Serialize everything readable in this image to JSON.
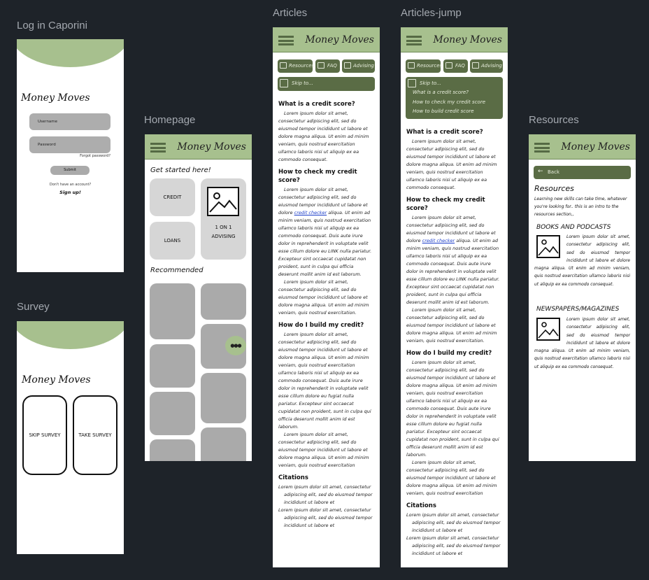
{
  "frames": {
    "login": "Log in Caporini",
    "homepage": "Homepage",
    "survey": "Survey",
    "articles": "Articles",
    "articles_jump": "Articles-jump",
    "resources": "Resources"
  },
  "app_title": "Money Moves",
  "login": {
    "username": "Username",
    "password": "Password",
    "forgot": "Forgot password?",
    "submit": "Submit",
    "no_account": "Don't have an account?",
    "signup": "Sign up!"
  },
  "survey": {
    "skip": "SKIP SURVEY",
    "take": "TAKE SURVEY"
  },
  "home": {
    "get_started": "Get started here!",
    "credit": "CREDIT",
    "loans": "LOANS",
    "advising": "1 ON 1 ADVISING",
    "recommended": "Recommended",
    "chat": "●●●"
  },
  "nav": {
    "resources": "Resources",
    "faq": "FAQ",
    "advising": "Advising",
    "skip": "Skip to..."
  },
  "jump": {
    "items": [
      "What is a credit score?",
      "How to check my credit score",
      "How to build credit score"
    ]
  },
  "articles": {
    "q1": "What is a credit score?",
    "p1": "Lorem ipsum dolor sit amet, consectetur adipiscing elit, sed do eiusmod  tempor incididunt ut labore et dolore magna aliqua. Ut enim ad minim veniam, quis nostrud exercitation ullamco laboris nisi ut aliquip ex ea  commodo consequat.",
    "q2": "How to check my credit score?",
    "p2a": "Lorem ipsum dolor sit amet, consectetur adipiscing elit, sed do eiusmod  tempor incididunt ut labore et dolore",
    "link": "credit checker",
    "p2b": "aliqua. Ut enim ad minim  veniam,  quis nostrud exercitation ullamco laboris nisi ut aliquip ex ea commodo consequat. Duis aute irure dolor in reprehenderit in voluptate  velit esse cillum dolore eu LINK nulla pariatur. Excepteur sint  occaecat cupidatat non proident, sunt in culpa qui officia deserunt  mollit anim id est laborum.",
    "p2c": "Lorem ipsum dolor sit amet, consectetur adipiscing elit, sed do eiusmod  tempor incididunt ut labore et dolore magna aliqua. Ut enim ad minim veniam, quis nostrud exercitation.",
    "q3": "How do I build my credit?",
    "p3a": "Lorem ipsum dolor sit amet, consectetur adipiscing elit, sed do eiusmod  tempor incididunt ut labore et dolore magna aliqua. Ut enim ad minim veniam, quis nostrud exercitation ullamco laboris nisi ut aliquip ex ea  commodo consequat. Duis aute irure dolor in reprehenderit in voluptate  velit esse cillum dolore eu fugiat nulla pariatur. Excepteur sint  occaecat cupidatat non proident, sunt in culpa qui officia deserunt  mollit anim id est laborum.",
    "p3b": "Lorem ipsum dolor sit amet, consectetur adipiscing elit, sed do eiusmod  tempor incididunt ut labore et dolore magna aliqua. Ut enim ad minim veniam, quis nostrud exercitation",
    "citations": "Citations",
    "c1": "Lorem ipsum dolor sit amet, consectetur adipiscing elit, sed do eiusmod tempor incididunt ut labore et",
    "c2": "Lorem ipsum dolor sit amet, consectetur adipiscing elit, sed do eiusmod tempor incididunt ut labore et"
  },
  "resources": {
    "back": "Back",
    "title": "Resources",
    "intro": "Learning new skills can take time, whatever you're looking for.. this is an intro to the resources section,,",
    "books": "BOOKS AND PODCASTS",
    "news": "NEWSPAPERS/MAGAZINES",
    "text": "Lorem ipsum dolor sit amet, consectetur adipiscing elit, sed do eiusmod tempor incididunt ut labore et dolore magna aliqua. Ut enim ad minim veniam, quis nostrud exercitation ullamco laboris nisi ut aliquip ex ea commodo consequat."
  }
}
